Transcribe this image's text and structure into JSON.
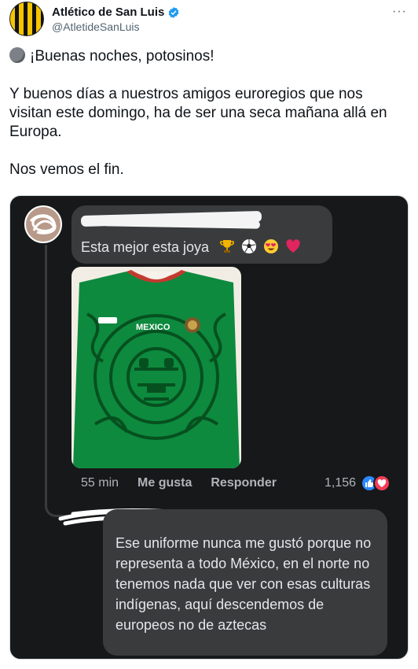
{
  "tweet": {
    "author_name": "Atlético de San Luis",
    "author_handle": "@AtletideSanLuis",
    "more_label": "···",
    "line1": "¡Buenas noches, potosinos!",
    "paragraph2": "Y buenos días a nuestros amigos euroregios que nos visitan este domingo, ha de ser una seca mañana allá en Europa.",
    "paragraph3": "Nos vemos el fin."
  },
  "screenshot": {
    "comment1": {
      "text": "Esta mejor esta joya",
      "emojis": [
        "trophy-emoji",
        "soccer-ball-emoji",
        "heart-eyes-emoji",
        "red-heart-emoji"
      ],
      "jersey_badge_text": "MEXICO",
      "time": "55 min",
      "like_label": "Me gusta",
      "reply_label": "Responder",
      "reaction_count": "1,156"
    },
    "comment2": {
      "text": "Ese uniforme nunca me gustó porque no representa a todo México, en el norte no tenemos nada que ver con esas culturas indígenas, aquí descendemos de europeos no de aztecas"
    }
  },
  "colors": {
    "verified": "#1d9bf0",
    "dark_bg": "#17181a",
    "bubble": "#3a3b3c",
    "like": "#2d88ff",
    "heart": "#f33e58",
    "jersey_green": "#0a7a3a"
  }
}
